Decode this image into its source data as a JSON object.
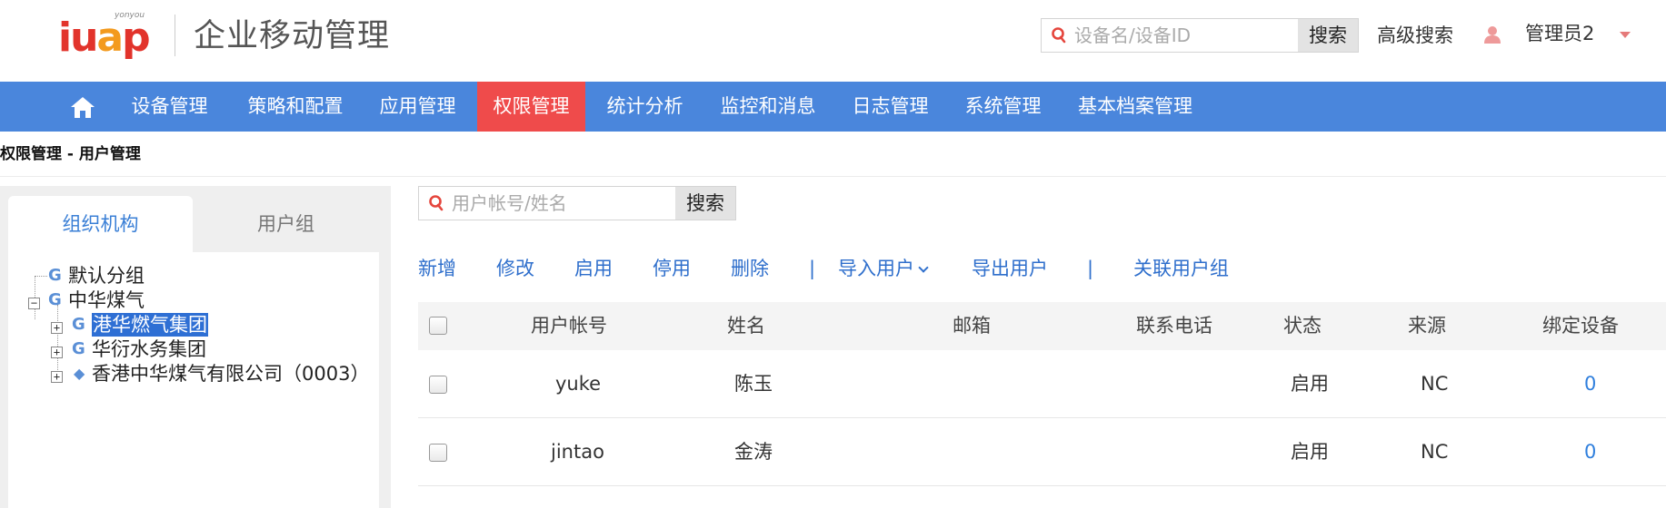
{
  "header": {
    "logo_text": "iuap",
    "logo_sub": "yonyou",
    "app_title": "企业移动管理",
    "device_search": {
      "placeholder": "设备名/设备ID",
      "button": "搜索"
    },
    "advanced_search": "高级搜索",
    "user_name": "管理员2"
  },
  "nav": {
    "items": [
      {
        "label": "设备管理"
      },
      {
        "label": "策略和配置"
      },
      {
        "label": "应用管理"
      },
      {
        "label": "权限管理",
        "active": true
      },
      {
        "label": "统计分析"
      },
      {
        "label": "监控和消息"
      },
      {
        "label": "日志管理"
      },
      {
        "label": "系统管理"
      },
      {
        "label": "基本档案管理"
      }
    ]
  },
  "breadcrumb": "权限管理 -  用户管理",
  "left": {
    "tabs": [
      {
        "label": "组织机构",
        "active": true
      },
      {
        "label": "用户组"
      }
    ],
    "tree": [
      {
        "label": "默认分组",
        "icon": "G"
      },
      {
        "label": "中华煤气",
        "icon": "G",
        "expanded": true
      },
      {
        "label": "港华燃气集团",
        "icon": "G",
        "selected": true
      },
      {
        "label": "华衍水务集团",
        "icon": "G"
      },
      {
        "label": "香港中华煤气有限公司（0003）",
        "icon": "diamond"
      }
    ]
  },
  "main": {
    "user_search": {
      "placeholder": "用户帐号/姓名",
      "button": "搜索"
    },
    "actions": {
      "add": "新增",
      "edit": "修改",
      "enable": "启用",
      "disable": "停用",
      "delete": "删除",
      "sep": "|",
      "import": "导入用户",
      "export": "导出用户",
      "link_group": "关联用户组"
    },
    "table": {
      "headers": [
        "用户帐号",
        "姓名",
        "邮箱",
        "联系电话",
        "状态",
        "来源",
        "绑定设备"
      ],
      "rows": [
        {
          "account": "yuke",
          "name": "陈玉",
          "email": "",
          "phone": "",
          "status": "启用",
          "source": "NC",
          "devices": "0"
        },
        {
          "account": "jintao",
          "name": "金涛",
          "email": "",
          "phone": "",
          "status": "启用",
          "source": "NC",
          "devices": "0"
        }
      ]
    }
  },
  "colors": {
    "nav_bg": "#4a86dc",
    "nav_active": "#ef4b4b",
    "link": "#2f6fcc",
    "logo_red": "#e2332b",
    "logo_orange": "#f39a1e"
  }
}
